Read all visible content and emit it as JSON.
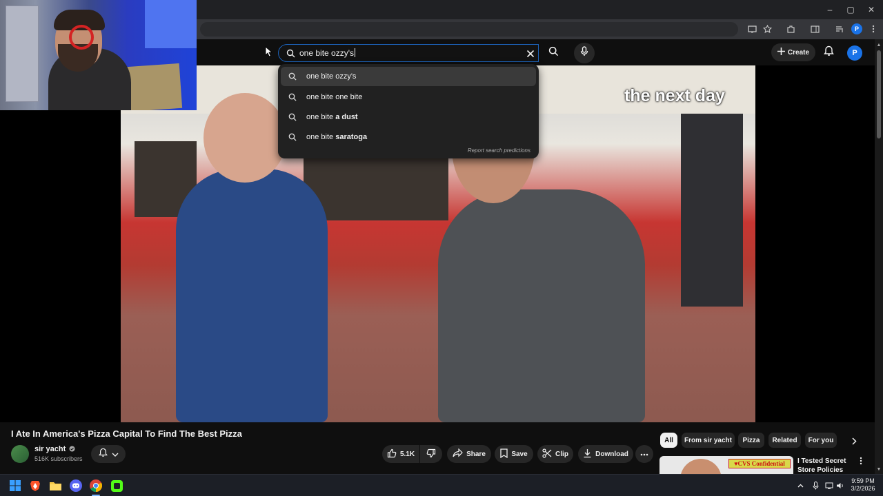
{
  "browser": {
    "window_controls": {
      "minimize": "–",
      "restore": "▢",
      "close": "✕"
    },
    "profile_initial": "P"
  },
  "masthead": {
    "search": {
      "value": "one bite ozzy's"
    },
    "create_label": "Create",
    "avatar_initial": "P"
  },
  "suggestions": {
    "items": [
      {
        "prefix": "one bite ozzy's",
        "bold": ""
      },
      {
        "prefix": "one bite one bite",
        "bold": ""
      },
      {
        "prefix": "one bite ",
        "bold": "a dust"
      },
      {
        "prefix": "one bite ",
        "bold": "saratoga"
      }
    ],
    "report_label": "Report search predictions"
  },
  "video": {
    "overlay_caption": "the next day",
    "title": "I Ate In America's Pizza Capital To Find The Best Pizza"
  },
  "channel": {
    "name": "sir yacht",
    "subscribers": "516K subscribers"
  },
  "actions": {
    "like_count": "5.1K",
    "share": "Share",
    "save": "Save",
    "clip": "Clip",
    "download": "Download"
  },
  "chips": [
    "All",
    "From sir yacht",
    "Pizza",
    "Related",
    "For you"
  ],
  "recommended": {
    "title": "I Tested Secret Store Policies",
    "thumb_banner": "♥CVS Confidential"
  },
  "taskbar": {
    "time": "9:59 PM",
    "date": "3/2/2026"
  },
  "colors": {
    "yt_bg": "#0f0f0f",
    "search_focus": "#1c62b9",
    "chip_active": "#f1f1f1"
  }
}
